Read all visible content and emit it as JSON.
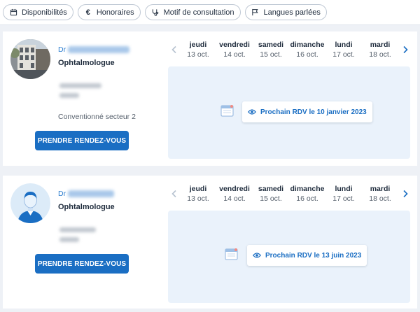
{
  "filters": [
    {
      "label": "Disponibilités",
      "icon": "calendar-icon"
    },
    {
      "label": "Honoraires",
      "icon": "euro-icon"
    },
    {
      "label": "Motif de consultation",
      "icon": "stethoscope-icon"
    },
    {
      "label": "Langues parlées",
      "icon": "flag-icon"
    }
  ],
  "colors": {
    "accent": "#1a6ec3",
    "slot_bg": "#eaf2fb",
    "page_bg": "#eef1f6"
  },
  "doctors": [
    {
      "prefix": "Dr",
      "specialty": "Ophtalmologue",
      "sector": "Conventionné secteur 2",
      "button": "PRENDRE RENDEZ-VOUS",
      "next_rdv": "Prochain RDV le 10 janvier 2023",
      "days": [
        {
          "name": "jeudi",
          "date": "13 oct."
        },
        {
          "name": "vendredi",
          "date": "14 oct."
        },
        {
          "name": "samedi",
          "date": "15 oct."
        },
        {
          "name": "dimanche",
          "date": "16 oct."
        },
        {
          "name": "lundi",
          "date": "17 oct."
        },
        {
          "name": "mardi",
          "date": "18 oct."
        }
      ]
    },
    {
      "prefix": "Dr",
      "specialty": "Ophtalmologue",
      "button": "PRENDRE RENDEZ-VOUS",
      "next_rdv": "Prochain RDV le 13 juin 2023",
      "days": [
        {
          "name": "jeudi",
          "date": "13 oct."
        },
        {
          "name": "vendredi",
          "date": "14 oct."
        },
        {
          "name": "samedi",
          "date": "15 oct."
        },
        {
          "name": "dimanche",
          "date": "16 oct."
        },
        {
          "name": "lundi",
          "date": "17 oct."
        },
        {
          "name": "mardi",
          "date": "18 oct."
        }
      ]
    }
  ]
}
